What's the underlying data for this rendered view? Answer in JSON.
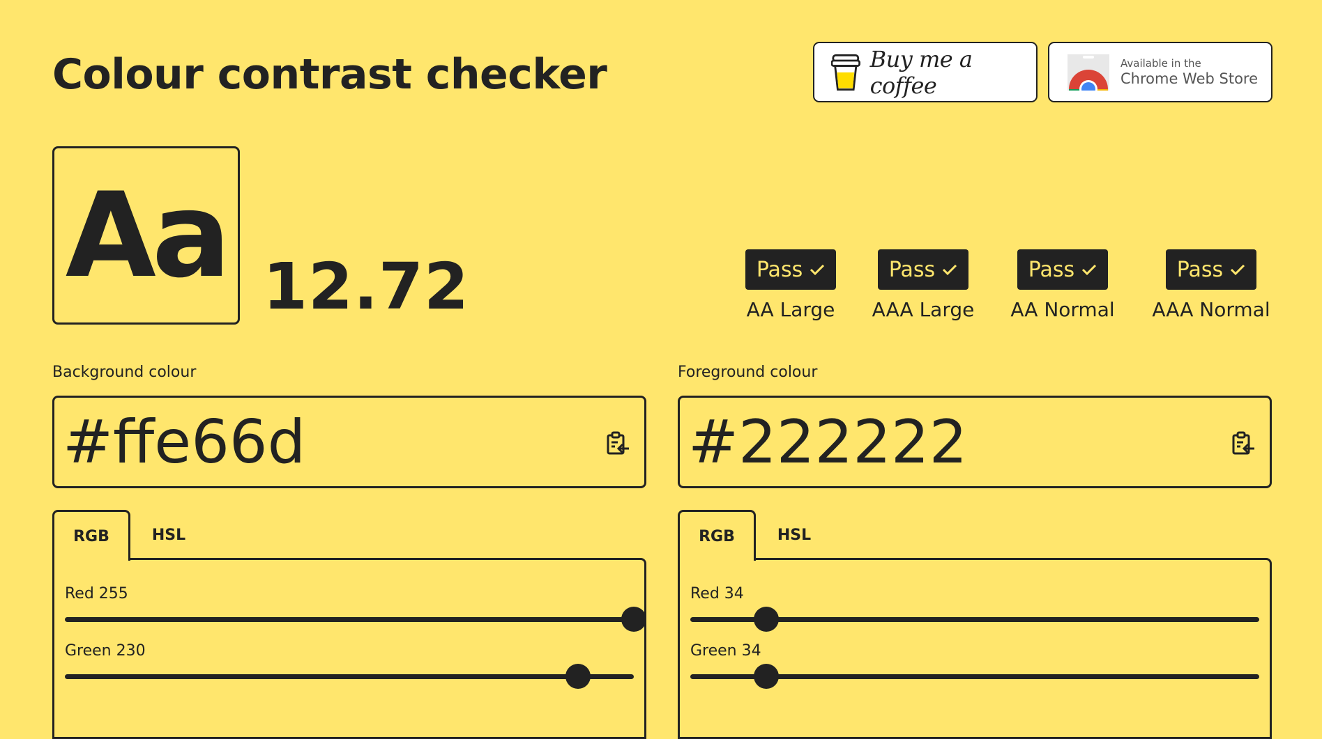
{
  "header": {
    "title": "Colour contrast checker",
    "coffee_label": "Buy me a coffee",
    "chrome_small": "Available in the",
    "chrome_big": "Chrome Web Store"
  },
  "preview": {
    "sample_text": "Aa",
    "ratio": "12.72"
  },
  "checks": [
    {
      "status": "Pass",
      "label": "AA Large"
    },
    {
      "status": "Pass",
      "label": "AAA Large"
    },
    {
      "status": "Pass",
      "label": "AA Normal"
    },
    {
      "status": "Pass",
      "label": "AAA Normal"
    }
  ],
  "background": {
    "label": "Background colour",
    "value": "#ffe66d",
    "tabs": [
      "RGB",
      "HSL"
    ],
    "sliders": [
      {
        "label": "Red 255",
        "level": 1.0
      },
      {
        "label": "Green 230",
        "level": 0.902
      }
    ]
  },
  "foreground": {
    "label": "Foreground colour",
    "value": "#222222",
    "tabs": [
      "RGB",
      "HSL"
    ],
    "sliders": [
      {
        "label": "Red 34",
        "level": 0.133
      },
      {
        "label": "Green 34",
        "level": 0.133
      }
    ]
  },
  "colors": {
    "background": "#ffe66d",
    "foreground": "#222222"
  },
  "icons": {
    "coffee": "coffee-cup-icon",
    "chrome": "chrome-logo-icon",
    "check": "checkmark-icon",
    "paste": "clipboard-paste-icon"
  }
}
